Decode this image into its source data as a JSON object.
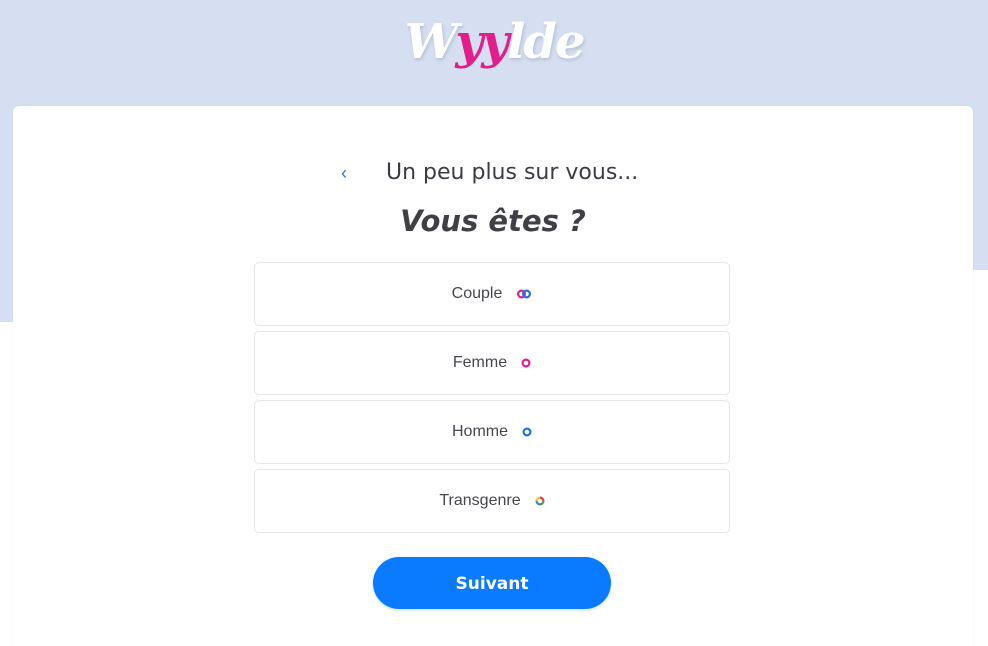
{
  "brand": {
    "logo_part1": "W",
    "logo_part2": "yy",
    "logo_part3": "lde",
    "logo_text": "Wyylde",
    "colors": {
      "logo_pink": "#e21e8c",
      "accent_blue": "#0a7bff",
      "background": "#d5dff1"
    }
  },
  "header": {
    "back_icon": "chevron-left-icon",
    "title": "Un peu plus sur vous..."
  },
  "question": "Vous êtes ?",
  "options": [
    {
      "label": "Couple",
      "icon": "couple-rings-icon"
    },
    {
      "label": "Femme",
      "icon": "pink-ring-icon"
    },
    {
      "label": "Homme",
      "icon": "blue-ring-icon"
    },
    {
      "label": "Transgenre",
      "icon": "rainbow-ring-icon"
    }
  ],
  "next_button": "Suivant"
}
